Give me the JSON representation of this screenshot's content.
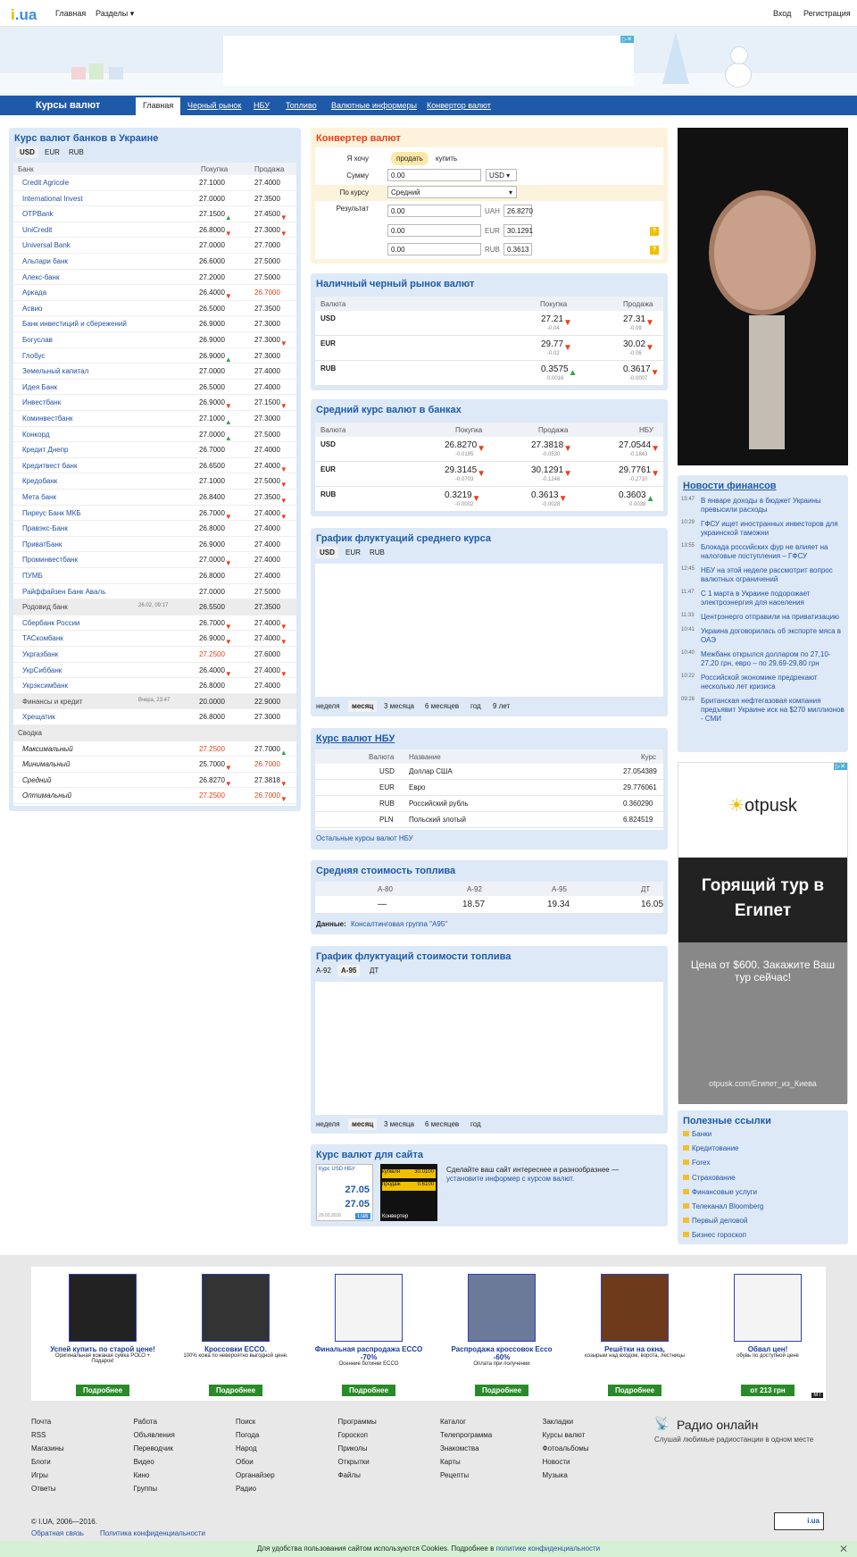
{
  "topbar": {
    "logo": "i.ua",
    "main": "Главная",
    "sections": "Разделы ▾",
    "login": "Вход",
    "register": "Регистрация"
  },
  "nav": {
    "title": "Курсы валют",
    "tabs": [
      "Главная",
      "Черный рынок",
      "НБУ",
      "Топливо",
      "Валютные информеры",
      "Конвертор валют"
    ]
  },
  "banks": {
    "title": "Курс валют банков в Украине",
    "currencies": [
      "USD",
      "EUR",
      "RUB"
    ],
    "headers": [
      "Банк",
      "Покупка",
      "Продажа"
    ],
    "rows": [
      {
        "name": "Credit Agricole",
        "buy": "27.1000",
        "sell": "27.4000"
      },
      {
        "name": "International Invest",
        "buy": "27.0000",
        "sell": "27.3500"
      },
      {
        "name": "OTPBank",
        "buy": "27.1500",
        "sell": "27.4500",
        "bd": "up",
        "sd": "dn"
      },
      {
        "name": "UniCredit",
        "buy": "26.8000",
        "sell": "27.3000",
        "bd": "dn",
        "sd": "dn"
      },
      {
        "name": "Universal Bank",
        "buy": "27.0000",
        "sell": "27.7000"
      },
      {
        "name": "Альпари банк",
        "buy": "26.6000",
        "sell": "27.5000"
      },
      {
        "name": "Алекс-банк",
        "buy": "27.2000",
        "sell": "27.5000"
      },
      {
        "name": "Аркада",
        "buy": "26.4000",
        "sell": "26.7000",
        "bd": "dn",
        "sred": true
      },
      {
        "name": "Асвио",
        "buy": "26.5000",
        "sell": "27.3500"
      },
      {
        "name": "Банк инвестиций и сбережений",
        "buy": "26.9000",
        "sell": "27.3000"
      },
      {
        "name": "Богуслав",
        "buy": "26.9000",
        "sell": "27.3000",
        "sd": "dn"
      },
      {
        "name": "Глобус",
        "buy": "26.9000",
        "sell": "27.3000",
        "bd": "up"
      },
      {
        "name": "Земельный капитал",
        "buy": "27.0000",
        "sell": "27.4000"
      },
      {
        "name": "Идея Банк",
        "buy": "26.5000",
        "sell": "27.4000"
      },
      {
        "name": "Инвестбанк",
        "buy": "26.9000",
        "sell": "27.1500",
        "bd": "dn",
        "sd": "dn"
      },
      {
        "name": "Коминвестбанк",
        "buy": "27.1000",
        "sell": "27.3000",
        "bd": "up"
      },
      {
        "name": "Конкорд",
        "buy": "27.0000",
        "sell": "27.5000",
        "bd": "up"
      },
      {
        "name": "Кредит Днепр",
        "buy": "26.7000",
        "sell": "27.4000"
      },
      {
        "name": "Кредитвест банк",
        "buy": "26.6500",
        "sell": "27.4000",
        "sd": "dn"
      },
      {
        "name": "Кредобанк",
        "buy": "27.1000",
        "sell": "27.5000",
        "sd": "dn"
      },
      {
        "name": "Мета банк",
        "buy": "26.8400",
        "sell": "27.3500",
        "sd": "dn"
      },
      {
        "name": "Пиреус Банк МКБ",
        "buy": "26.7000",
        "sell": "27.4000",
        "bd": "dn",
        "sd": "dn"
      },
      {
        "name": "Правэкс-Банк",
        "buy": "26.8000",
        "sell": "27.4000"
      },
      {
        "name": "ПриватБанк",
        "buy": "26.9000",
        "sell": "27.4000"
      },
      {
        "name": "Проминвестбанк",
        "buy": "27.0000",
        "sell": "27.4000",
        "bd": "dn"
      },
      {
        "name": "ПУМБ",
        "buy": "26.8000",
        "sell": "27.4000"
      },
      {
        "name": "Райффайзен Банк Аваль",
        "buy": "27.0000",
        "sell": "27.5000"
      },
      {
        "name": "Родовид банк",
        "buy": "26.5500",
        "sell": "27.3500",
        "gray": true,
        "date": "26.02, 09:17"
      },
      {
        "name": "Сбербанк России",
        "buy": "26.7000",
        "sell": "27.4000",
        "bd": "dn",
        "sd": "dn"
      },
      {
        "name": "ТАСкомбанк",
        "buy": "26.9000",
        "sell": "27.4000",
        "bd": "dn",
        "sd": "dn"
      },
      {
        "name": "Укргазбанк",
        "buy": "27.2500",
        "sell": "27.6000",
        "bred": true
      },
      {
        "name": "УкрСиббанк",
        "buy": "26.4000",
        "sell": "27.4000",
        "bd": "dn",
        "sd": "dn"
      },
      {
        "name": "Укрэксимбанк",
        "buy": "26.8000",
        "sell": "27.4000"
      },
      {
        "name": "Финансы и кредит",
        "buy": "20.0000",
        "sell": "22.9000",
        "gray": true,
        "date": "Вчера, 23:47"
      },
      {
        "name": "Хрещатик",
        "buy": "26.8000",
        "sell": "27.3000"
      }
    ],
    "summary_title": "Сводка",
    "summary": [
      {
        "name": "Максимальный",
        "buy": "27.2500",
        "sell": "27.7000",
        "bred": true,
        "sd": "up"
      },
      {
        "name": "Минимальный",
        "buy": "25.7000",
        "sell": "26.7000",
        "bd": "dn",
        "sred": true
      },
      {
        "name": "Средний",
        "buy": "26.8270",
        "sell": "27.3818",
        "bd": "dn",
        "sd": "dn"
      },
      {
        "name": "Оптимальный",
        "buy": "27.2500",
        "sell": "26.7000",
        "bred": true,
        "sred": true,
        "sd": "dn"
      }
    ]
  },
  "converter": {
    "title": "Конвертер валют",
    "want_label": "Я хочу",
    "sell": "продать",
    "buy": "купить",
    "sum_label": "Сумму",
    "sum_value": "0.00",
    "currency": "USD",
    "rate_label": "По курсу",
    "rate_value": "Средний",
    "result_label": "Результат",
    "results": [
      {
        "value": "0.00",
        "cur": "UAH",
        "rate": "26.8270"
      },
      {
        "value": "0.00",
        "cur": "EUR",
        "rate": "30.1291"
      },
      {
        "value": "0.00",
        "cur": "RUB",
        "rate": "0.3613"
      }
    ]
  },
  "black": {
    "title": "Наличный черный рынок валют",
    "headers": [
      "Валюта",
      "Покупка",
      "Продажа"
    ],
    "rows": [
      {
        "cur": "USD",
        "buy": "27.21",
        "bch": "-0.04",
        "sell": "27.31",
        "sch": "-0.09",
        "bd": "dn",
        "sd": "dn"
      },
      {
        "cur": "EUR",
        "buy": "29.77",
        "bch": "-0.02",
        "sell": "30.02",
        "sch": "-0.06",
        "bd": "dn",
        "sd": "dn"
      },
      {
        "cur": "RUB",
        "buy": "0.3575",
        "bch": "0.0016",
        "sell": "0.3617",
        "sch": "-0.0007",
        "bd": "up",
        "sd": "dn"
      }
    ]
  },
  "avg": {
    "title": "Средний курс валют в банках",
    "headers": [
      "Валюта",
      "Покупка",
      "Продажа",
      "НБУ"
    ],
    "rows": [
      {
        "cur": "USD",
        "buy": "26.8270",
        "bch": "-0.0195",
        "sell": "27.3818",
        "sch": "-0.0530",
        "nbu": "27.0544",
        "nch": "-0.1843",
        "bd": "dn",
        "sd": "dn",
        "nd": "dn"
      },
      {
        "cur": "EUR",
        "buy": "29.3145",
        "bch": "-0.0703",
        "sell": "30.1291",
        "sch": "-0.1248",
        "nbu": "29.7761",
        "nch": "-0.2710",
        "bd": "dn",
        "sd": "dn",
        "nd": "dn"
      },
      {
        "cur": "RUB",
        "buy": "0.3219",
        "bch": "-0.0002",
        "sell": "0.3613",
        "sch": "-0.0028",
        "nbu": "0.3603",
        "nch": "0.0038",
        "bd": "dn",
        "sd": "dn",
        "nd": "up"
      }
    ]
  },
  "flux": {
    "title": "График флуктуаций среднего курса",
    "currencies": [
      "USD",
      "EUR",
      "RUB"
    ],
    "periods": [
      "неделя",
      "месяц",
      "3 месяца",
      "6 месяцев",
      "год",
      "9 лет"
    ]
  },
  "nbu": {
    "title": "Курс валют НБУ",
    "headers": [
      "Валюта",
      "Название",
      "Курс"
    ],
    "rows": [
      {
        "cur": "USD",
        "name": "Доллар США",
        "rate": "27.054389"
      },
      {
        "cur": "EUR",
        "name": "Евро",
        "rate": "29.776061"
      },
      {
        "cur": "RUB",
        "name": "Российский рубль",
        "rate": "0.360290"
      },
      {
        "cur": "PLN",
        "name": "Польский злотый",
        "rate": "6.824519"
      }
    ],
    "more": "Остальные курсы валют НБУ"
  },
  "fuel": {
    "title": "Средняя стоимость топлива",
    "headers": [
      "А-80",
      "А-92",
      "А-95",
      "ДТ"
    ],
    "values": [
      "—",
      "18.57",
      "19.34",
      "16.05"
    ],
    "source_label": "Данные:",
    "source": "Консалтинговая группа \"А95\""
  },
  "fuelflux": {
    "title": "График флуктуаций стоимости топлива",
    "types": [
      "А-92",
      "А-95",
      "ДТ"
    ],
    "periods": [
      "неделя",
      "месяц",
      "3 месяца",
      "6 месяцев",
      "год"
    ]
  },
  "site": {
    "title": "Курс валют для сайта",
    "text": "Сделайте ваш сайт интереснее и разнообразнее —",
    "link": "установите информер с курсом валют.",
    "inf1_title": "Курс USD НБУ",
    "inf1_v1": "27.05",
    "inf1_v2": "27.05",
    "inf1_date": "29.02.2016",
    "inf2_buy": "купівля",
    "inf2_sell": "продаж",
    "inf2_v1": "30.0100",
    "inf2_v2": "0.6100",
    "inf2_foot": "Конвертер"
  },
  "news": {
    "title": "Новости финансов",
    "items": [
      {
        "t": "15:47",
        "text": "В январе доходы в бюджет Украины превысили расходы"
      },
      {
        "t": "10:29",
        "text": "ГФСУ ищет иностранных инвесторов для украинской таможни"
      },
      {
        "t": "13:55",
        "text": "Блокада российских фур не влияет на налоговые поступления – ГФСУ"
      },
      {
        "t": "12:45",
        "text": "НБУ на этой неделе рассмотрит вопрос валютных ограничений"
      },
      {
        "t": "11:47",
        "text": "С 1 марта в Украине подорожает электроэнергия для населения"
      },
      {
        "t": "11:33",
        "text": "Центрэнерго отправили на приватизацию"
      },
      {
        "t": "10:41",
        "text": "Украина договорилась об экспорте мяса в ОАЭ"
      },
      {
        "t": "10:40",
        "text": "Межбанк открылся долларом по 27,10-27,20 грн, евро – по 29,69-29,80 грн"
      },
      {
        "t": "10:22",
        "text": "Российской экономике предрекают несколько лет кризиса"
      },
      {
        "t": "09:28",
        "text": "Британская нефтегазовая компания предъявит Украине иск на $270 миллионов - СМИ"
      }
    ]
  },
  "ad": {
    "brand": "otpusk",
    "headline": "Горящий тур в Египет",
    "sub": "Цена от $600. Закажите Ваш тур сейчас!",
    "url": "otpusk.com/Египет_из_Киева"
  },
  "links": {
    "title": "Полезные ссылки",
    "items": [
      "Банки",
      "Кредитование",
      "Forex",
      "Страхование",
      "Финансовые услуги",
      "Телеканал Bloomberg",
      "Первый деловой",
      "Бизнес гороскоп"
    ]
  },
  "promo": [
    {
      "title": "Успей купить по старой цене!",
      "sub": "Оригинальная кожаная сумка POLO + Подарок!",
      "btn": "Подробнее"
    },
    {
      "title": "Кроссовки ECCO.",
      "sub": "100% кожа по невероятно выгодной цене.",
      "btn": "Подробнее",
      "badge": "ecco",
      "year": "2016"
    },
    {
      "title": "Финальная распродажа ECCO -70%",
      "sub": "Осенние ботинки ECCO",
      "btn": "Подробнее",
      "badge": "ecco"
    },
    {
      "title": "Распродажа кроссовок Ecco -60%",
      "sub": "Оплата при получении",
      "btn": "Подробнее"
    },
    {
      "title": "Решётки на окна,",
      "sub": "козырьки над входом, ворота, лестницы",
      "btn": "Подробнее"
    },
    {
      "title": "Обвал цен!",
      "sub": "обувь по доступной цене",
      "btn": "от 213 грн",
      "badge": "lamoda"
    }
  ],
  "footer": {
    "cols": [
      [
        "Почта",
        "RSS",
        "Магазины",
        "Блоги",
        "Игры",
        "Ответы"
      ],
      [
        "Работа",
        "Объявления",
        "Переводчик",
        "Видео",
        "Кино",
        "Группы"
      ],
      [
        "Поиск",
        "Погода",
        "Народ",
        "Обои",
        "Органайзер",
        "Радио"
      ],
      [
        "Программы",
        "Гороскоп",
        "Приколы",
        "Открытки",
        "Файлы"
      ],
      [
        "Каталог",
        "Телепрограмма",
        "Знакомства",
        "Карты",
        "Рецепты"
      ],
      [
        "Закладки",
        "Курсы валют",
        "Фотоальбомы",
        "Новости",
        "Музыка"
      ]
    ],
    "radio_title": "Радио онлайн",
    "radio_text": "Слушай любимые радиостанции в одном месте",
    "copyright": "© I.UA, 2006—2016.",
    "feedback": "Обратная связь",
    "privacy": "Политика конфиденциальности"
  },
  "cookie": {
    "text": "Для удобства пользования сайтом используются Cookies. Подробнее в",
    "link": "политике конфиденциальности"
  }
}
